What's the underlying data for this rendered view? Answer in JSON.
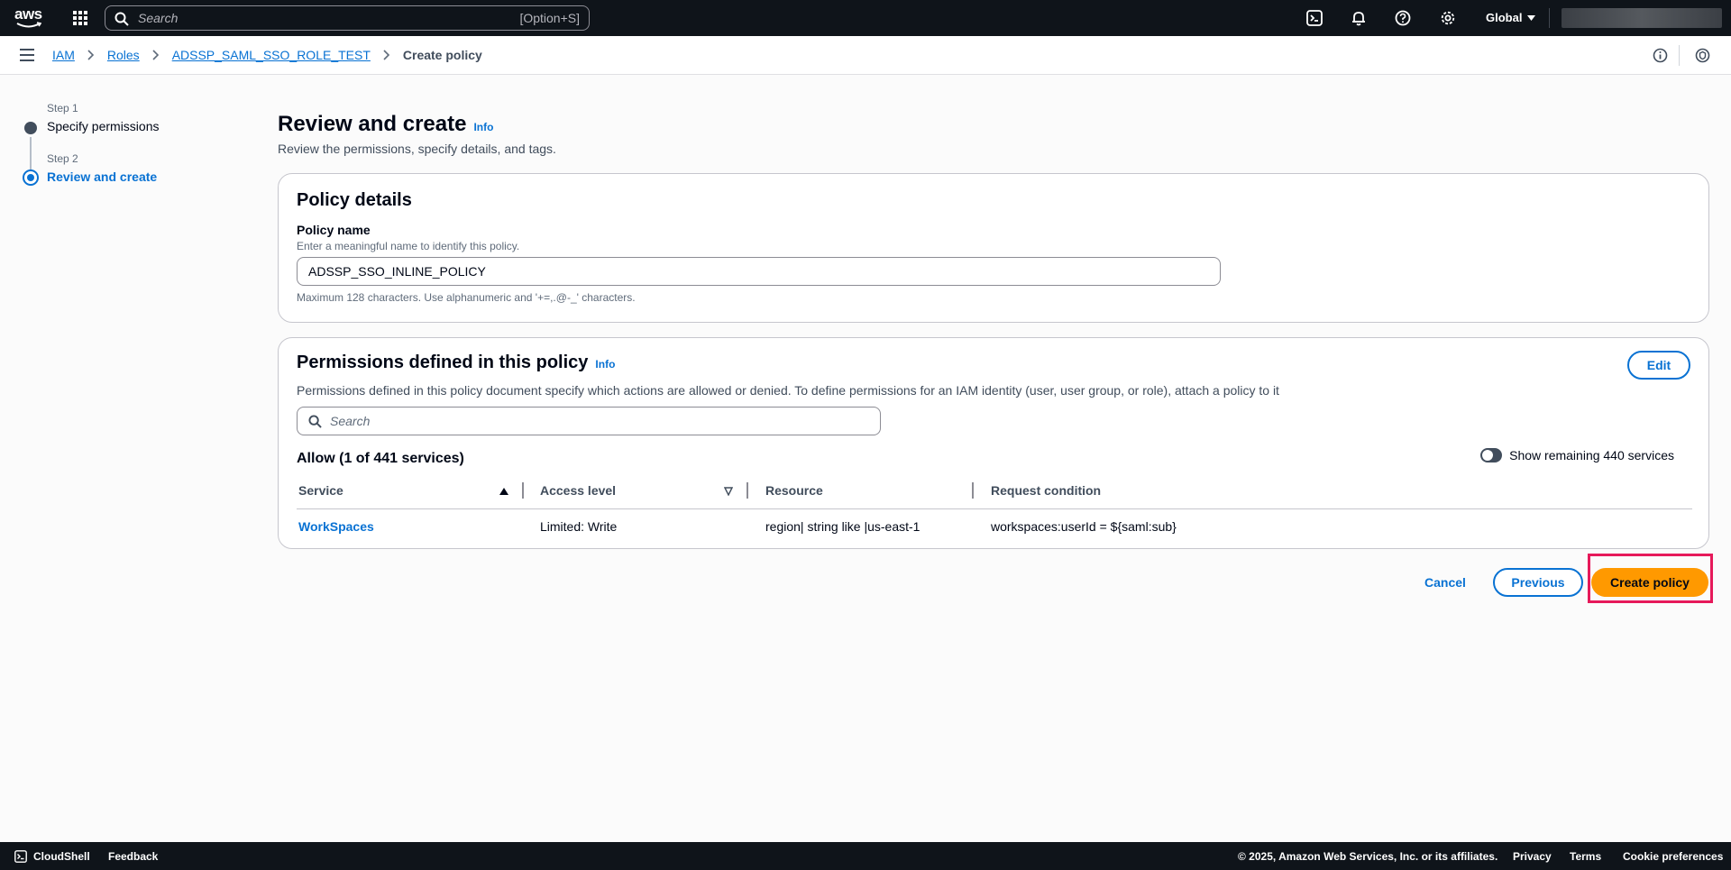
{
  "topnav": {
    "logo_text": "aws",
    "search_placeholder": "Search",
    "search_shortcut": "[Option+S]",
    "region": "Global",
    "icons": [
      "grid-icon",
      "search-icon",
      "cloudshell-icon",
      "bell-icon",
      "help-icon",
      "gear-icon"
    ]
  },
  "breadcrumb": {
    "items": [
      "IAM",
      "Roles",
      "ADSSP_SAML_SSO_ROLE_TEST"
    ],
    "current": "Create policy"
  },
  "steps": [
    {
      "label": "Step 1",
      "name": "Specify permissions",
      "state": "done"
    },
    {
      "label": "Step 2",
      "name": "Review and create",
      "state": "active"
    }
  ],
  "page": {
    "title": "Review and create",
    "info": "Info",
    "description": "Review the permissions, specify details, and tags."
  },
  "policy_details": {
    "title": "Policy details",
    "name_label": "Policy name",
    "name_desc": "Enter a meaningful name to identify this policy.",
    "name_value": "ADSSP_SSO_INLINE_POLICY",
    "name_hint": "Maximum 128 characters. Use alphanumeric and '+=,.@-_' characters."
  },
  "permissions": {
    "title": "Permissions defined in this policy",
    "info": "Info",
    "edit_label": "Edit",
    "description": "Permissions defined in this policy document specify which actions are allowed or denied. To define permissions for an IAM identity (user, user group, or role), attach a policy to it",
    "search_placeholder": "Search",
    "allow_title": "Allow (1 of 441 services)",
    "toggle_label": "Show remaining 440 services",
    "columns": [
      "Service",
      "Access level",
      "Resource",
      "Request condition"
    ],
    "rows": [
      {
        "service": "WorkSpaces",
        "access": "Limited: Write",
        "resource": "region| string like |us-east-1",
        "condition": "workspaces:userId = ${saml:sub}"
      }
    ]
  },
  "actions": {
    "cancel": "Cancel",
    "previous": "Previous",
    "create": "Create policy"
  },
  "footer": {
    "cloudshell": "CloudShell",
    "feedback": "Feedback",
    "copyright": "© 2025, Amazon Web Services, Inc. or its affiliates.",
    "privacy": "Privacy",
    "terms": "Terms",
    "cookies": "Cookie preferences"
  },
  "colors": {
    "nav_bg": "#0f141a",
    "link": "#0972d3",
    "primary_button": "#ff9900",
    "highlight_outline": "#e6195a"
  }
}
